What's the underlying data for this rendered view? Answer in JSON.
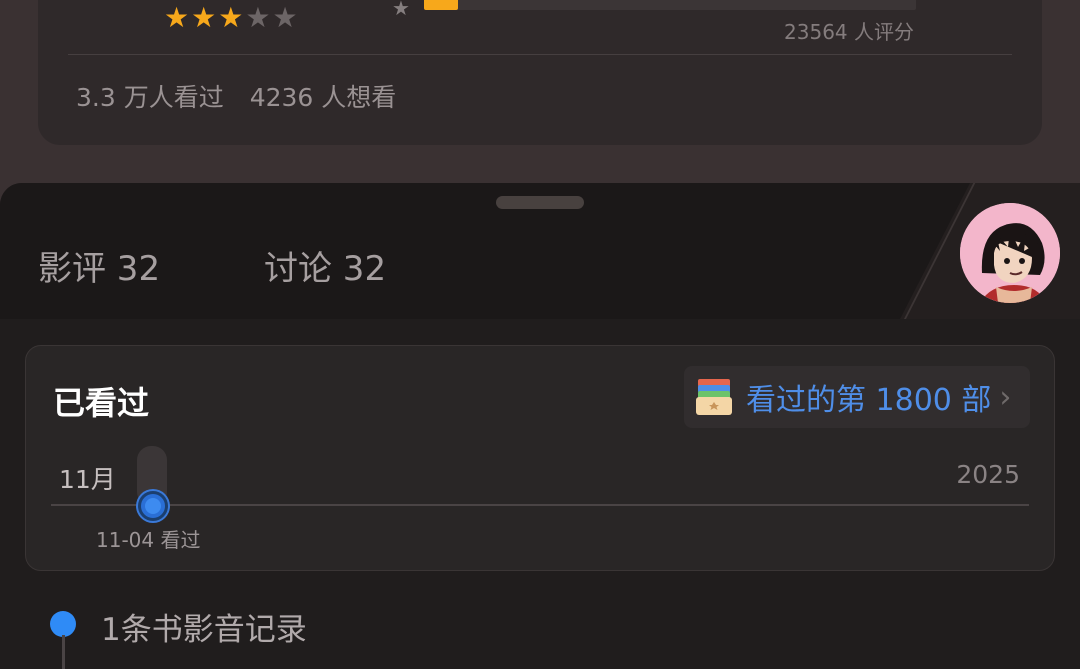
{
  "rating_card": {
    "stars": {
      "filled": 3,
      "total": 5
    },
    "distribution_star": "★",
    "distribution_fill_fraction": 0.07,
    "rating_count": "23564 人评分",
    "stats": [
      "3.3 万人看过",
      "4236 人想看"
    ]
  },
  "tabs": [
    {
      "label": "影评 32"
    },
    {
      "label": "讨论 32"
    }
  ],
  "watched": {
    "title": "已看过",
    "badge_text": "看过的第 1800 部",
    "timeline_month": "11月",
    "timeline_year": "2025",
    "timeline_label": "11-04 看过"
  },
  "record": {
    "text": "1条书影音记录"
  },
  "colors": {
    "star": "#f7a81b",
    "accent": "#4f8ee8",
    "dot": "#2f8bf6"
  },
  "icons": {
    "avatar": "avatar",
    "badge": "archive-box-icon",
    "chevron": "chevron-right-icon"
  }
}
